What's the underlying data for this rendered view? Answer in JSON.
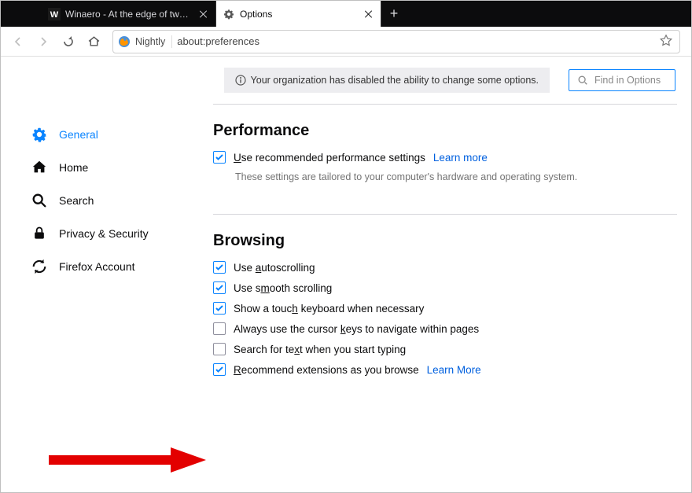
{
  "tabs": [
    {
      "title": "Winaero - At the edge of tweaking",
      "active": false
    },
    {
      "title": "Options",
      "active": true
    }
  ],
  "urlbar": {
    "identity": "Nightly",
    "url": "about:preferences"
  },
  "banner": "Your organization has disabled the ability to change some options.",
  "search": {
    "placeholder": "Find in Options"
  },
  "sidebar": {
    "items": [
      {
        "label": "General",
        "selected": true
      },
      {
        "label": "Home"
      },
      {
        "label": "Search"
      },
      {
        "label": "Privacy & Security"
      },
      {
        "label": "Firefox Account"
      }
    ]
  },
  "sections": {
    "performance": {
      "title": "Performance",
      "recommended": {
        "label": "Use recommended performance settings",
        "checked": true,
        "learn": "Learn more"
      },
      "subtext": "These settings are tailored to your computer's hardware and operating system."
    },
    "browsing": {
      "title": "Browsing",
      "items": [
        {
          "label": "Use autoscrolling",
          "checked": true
        },
        {
          "label": "Use smooth scrolling",
          "checked": true
        },
        {
          "label": "Show a touch keyboard when necessary",
          "checked": true
        },
        {
          "label": "Always use the cursor keys to navigate within pages",
          "checked": false
        },
        {
          "label": "Search for text when you start typing",
          "checked": false
        },
        {
          "label": "Recommend extensions as you browse",
          "checked": true,
          "learn": "Learn More"
        }
      ]
    }
  }
}
